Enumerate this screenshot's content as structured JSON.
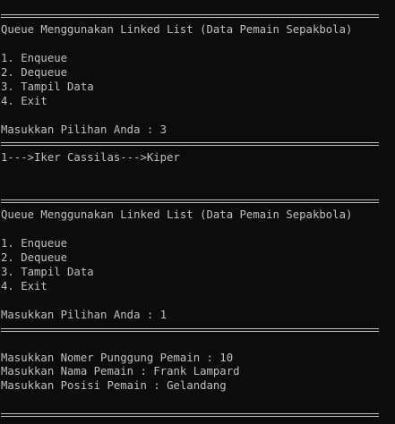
{
  "console": {
    "lines": [
      {
        "type": "sep",
        "text": ""
      },
      {
        "type": "text",
        "text": "Queue Menggunakan Linked List (Data Pemain Sepakbola)"
      },
      {
        "type": "text",
        "text": ""
      },
      {
        "type": "text",
        "text": "1. Enqueue"
      },
      {
        "type": "text",
        "text": "2. Dequeue"
      },
      {
        "type": "text",
        "text": "3. Tampil Data"
      },
      {
        "type": "text",
        "text": "4. Exit"
      },
      {
        "type": "text",
        "text": ""
      },
      {
        "type": "text",
        "text": "Masukkan Pilihan Anda : 3"
      },
      {
        "type": "sep",
        "text": ""
      },
      {
        "type": "text",
        "text": "1--->Iker Cassilas--->Kiper"
      },
      {
        "type": "text",
        "text": ""
      },
      {
        "type": "text",
        "text": ""
      },
      {
        "type": "sep",
        "text": ""
      },
      {
        "type": "text",
        "text": "Queue Menggunakan Linked List (Data Pemain Sepakbola)"
      },
      {
        "type": "text",
        "text": ""
      },
      {
        "type": "text",
        "text": "1. Enqueue"
      },
      {
        "type": "text",
        "text": "2. Dequeue"
      },
      {
        "type": "text",
        "text": "3. Tampil Data"
      },
      {
        "type": "text",
        "text": "4. Exit"
      },
      {
        "type": "text",
        "text": ""
      },
      {
        "type": "text",
        "text": "Masukkan Pilihan Anda : 1"
      },
      {
        "type": "sep",
        "text": ""
      },
      {
        "type": "text",
        "text": ""
      },
      {
        "type": "text",
        "text": "Masukkan Nomer Punggung Pemain : 10"
      },
      {
        "type": "text",
        "text": "Masukkan Nama Pemain : Frank Lampard"
      },
      {
        "type": "text",
        "text": "Masukkan Posisi Pemain : Gelandang"
      },
      {
        "type": "text",
        "text": ""
      },
      {
        "type": "sep",
        "text": ""
      }
    ]
  }
}
